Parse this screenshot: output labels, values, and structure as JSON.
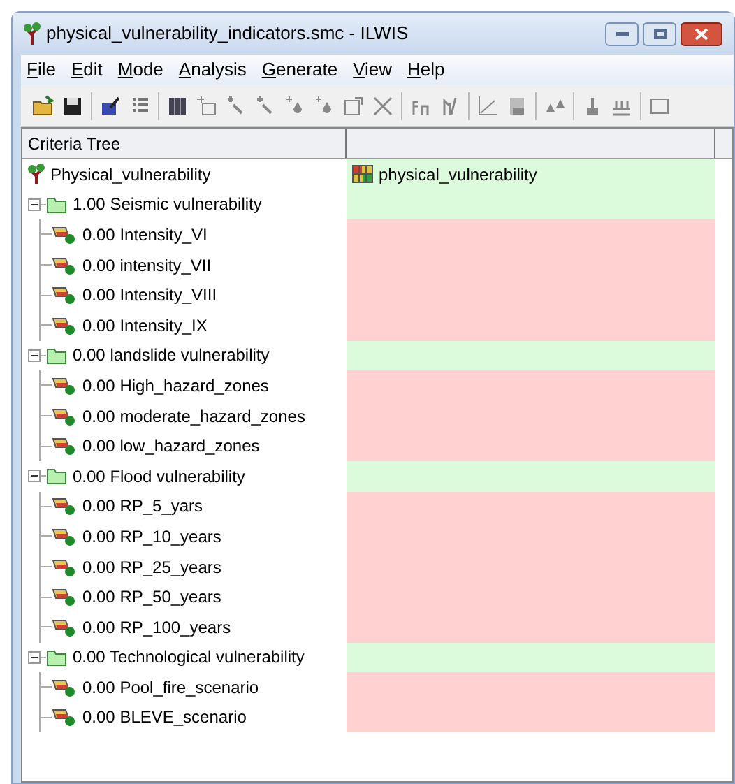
{
  "window": {
    "title": "physical_vulnerability_indicators.smc - ILWIS"
  },
  "menu": [
    {
      "label": "File"
    },
    {
      "label": "Edit"
    },
    {
      "label": "Mode"
    },
    {
      "label": "Analysis"
    },
    {
      "label": "Generate"
    },
    {
      "label": "View"
    },
    {
      "label": "Help"
    }
  ],
  "tree": {
    "header": "Criteria Tree",
    "root": {
      "label": "Physical_vulnerability",
      "output": "physical_vulnerability",
      "children": [
        {
          "weight": "1.00",
          "label": "Seismic vulnerability",
          "expanded": true,
          "children": [
            {
              "weight": "0.00",
              "label": "Intensity_VI"
            },
            {
              "weight": "0.00",
              "label": "intensity_VII"
            },
            {
              "weight": "0.00",
              "label": "Intensity_VIII"
            },
            {
              "weight": "0.00",
              "label": "Intensity_IX"
            }
          ]
        },
        {
          "weight": "0.00",
          "label": "landslide vulnerability",
          "expanded": true,
          "children": [
            {
              "weight": "0.00",
              "label": "High_hazard_zones"
            },
            {
              "weight": "0.00",
              "label": "moderate_hazard_zones"
            },
            {
              "weight": "0.00",
              "label": "low_hazard_zones"
            }
          ]
        },
        {
          "weight": "0.00",
          "label": "Flood vulnerability",
          "expanded": true,
          "children": [
            {
              "weight": "0.00",
              "label": "RP_5_yars"
            },
            {
              "weight": "0.00",
              "label": "RP_10_years"
            },
            {
              "weight": "0.00",
              "label": "RP_25_years"
            },
            {
              "weight": "0.00",
              "label": "RP_50_years"
            },
            {
              "weight": "0.00",
              "label": "RP_100_years"
            }
          ]
        },
        {
          "weight": "0.00",
          "label": "Technological vulnerability",
          "expanded": true,
          "children": [
            {
              "weight": "0.00",
              "label": "Pool_fire_scenario"
            },
            {
              "weight": "0.00",
              "label": "BLEVE_scenario"
            }
          ]
        }
      ]
    }
  }
}
